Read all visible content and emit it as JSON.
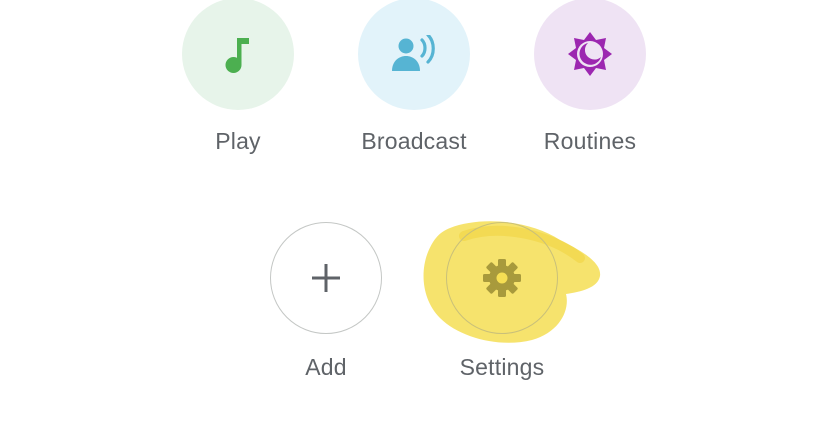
{
  "actions": {
    "play": {
      "label": "Play",
      "bg": "#e7f4ea",
      "icon_color": "#4caf50",
      "icon": "music-note-icon"
    },
    "broadcast": {
      "label": "Broadcast",
      "bg": "#e2f3fa",
      "icon_color": "#56b4d3",
      "icon": "broadcast-icon"
    },
    "routines": {
      "label": "Routines",
      "bg": "#efe3f4",
      "icon_color": "#9c27b0",
      "icon": "routines-sun-moon-icon"
    },
    "add": {
      "label": "Add",
      "icon_color": "#5f6368",
      "icon": "plus-icon"
    },
    "settings": {
      "label": "Settings",
      "icon_color": "#8a8a3a",
      "icon": "gear-icon"
    }
  },
  "annotation": {
    "color": "#f5de54",
    "icon": "highlighter-scribble"
  }
}
